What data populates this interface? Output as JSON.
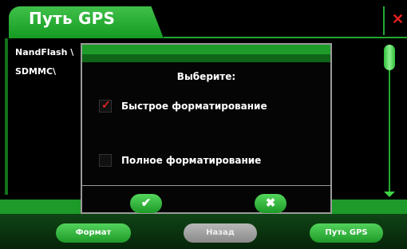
{
  "window": {
    "title": "Путь GPS",
    "close_symbol": "✕"
  },
  "list": {
    "items": [
      "NandFlash \\",
      "SDMMC\\"
    ]
  },
  "dialog": {
    "title": "Выберите:",
    "options": [
      {
        "label": "Быстрое форматирование",
        "checked": true,
        "mark": "✓"
      },
      {
        "label": "Полное форматирование",
        "checked": false,
        "mark": ""
      }
    ],
    "ok_symbol": "✔",
    "cancel_symbol": "✖"
  },
  "bottom_bar": {
    "format_label": "Формат",
    "back_label": "Назад",
    "gps_path_label": "Путь GPS"
  },
  "colors": {
    "accent_green": "#1d9a29",
    "check_red": "#e02424",
    "close_red": "#e02020",
    "disabled_gray": "#a0a0a0"
  }
}
